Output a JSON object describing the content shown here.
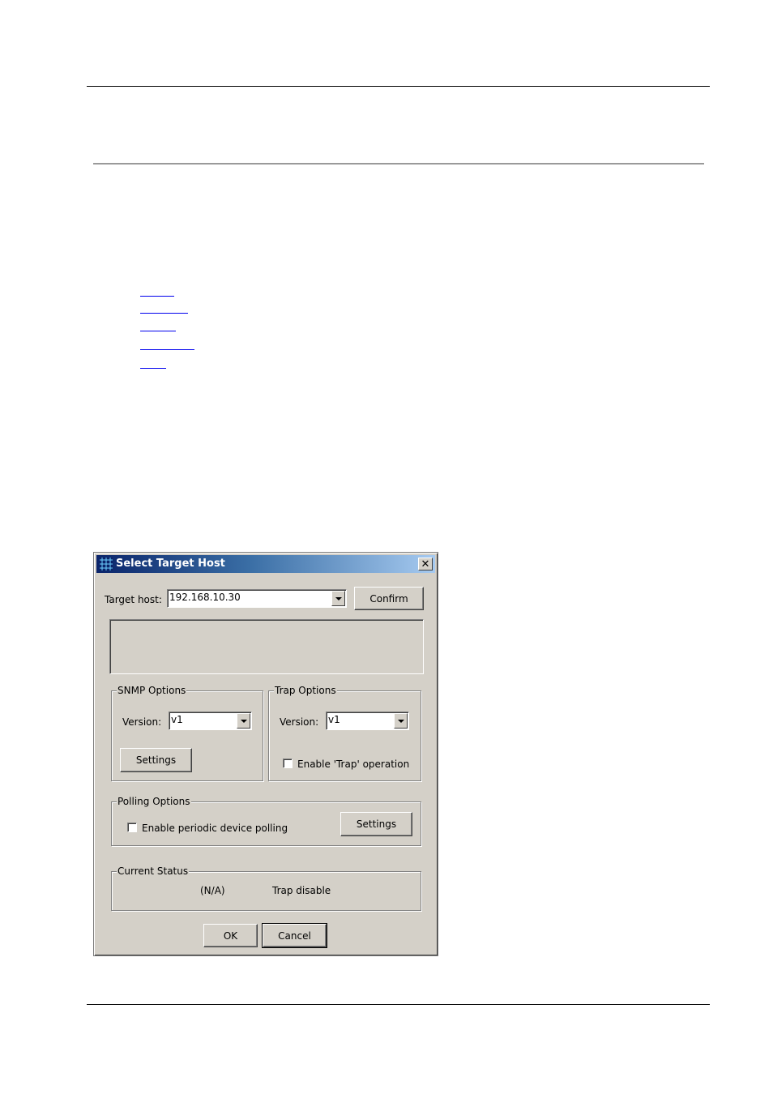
{
  "dialog": {
    "title": "Select Target Host",
    "close_glyph": "✕",
    "target_host": {
      "label": "Target host:",
      "value": "192.168.10.30"
    },
    "confirm_label": "Confirm",
    "snmp_options": {
      "title": "SNMP Options",
      "version_label": "Version:",
      "version_value": "v1",
      "settings_label": "Settings"
    },
    "trap_options": {
      "title": "Trap Options",
      "version_label": "Version:",
      "version_value": "v1",
      "enable_label": "Enable 'Trap' operation",
      "enabled": false
    },
    "polling_options": {
      "title": "Polling Options",
      "enable_label": "Enable periodic device polling",
      "enabled": false,
      "settings_label": "Settings"
    },
    "current_status": {
      "title": "Current Status",
      "value": "(N/A)",
      "trap": "Trap disable"
    },
    "ok_label": "OK",
    "cancel_label": "Cancel"
  }
}
